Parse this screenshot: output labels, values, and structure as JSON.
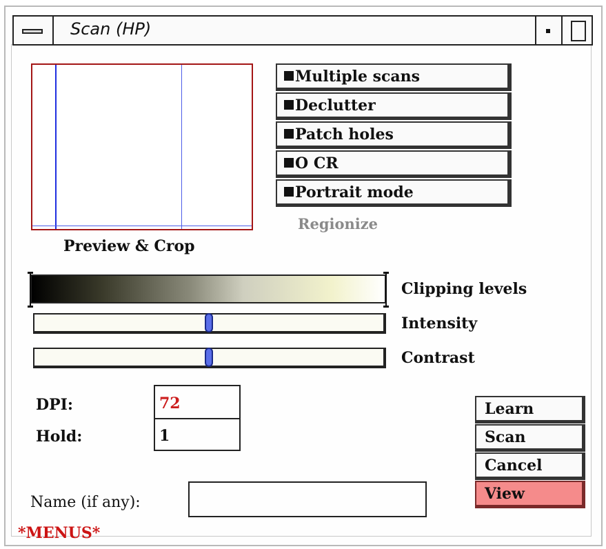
{
  "window": {
    "title": "Scan (HP)"
  },
  "titlebar_icons": {
    "menu": "window-menu-icon",
    "minimize": "minimize-icon",
    "maximize": "maximize-icon"
  },
  "preview": {
    "label": "Preview & Crop"
  },
  "options": [
    {
      "label": "Multiple scans"
    },
    {
      "label": "Declutter"
    },
    {
      "label": "Patch holes"
    },
    {
      "label": "O CR"
    },
    {
      "label": "Portrait mode"
    }
  ],
  "regionize": {
    "label": "Regionize"
  },
  "clipping": {
    "label": "Clipping levels",
    "low": 0,
    "high": 1
  },
  "intensity": {
    "label": "Intensity",
    "value": 0.5
  },
  "contrast": {
    "label": "Contrast",
    "value": 0.5
  },
  "dpi": {
    "label": "DPI:",
    "value": "72"
  },
  "hold": {
    "label": "Hold:",
    "value": "1"
  },
  "name": {
    "label": "Name (if any):",
    "value": ""
  },
  "actions": {
    "learn": "Learn",
    "scan": "Scan",
    "cancel": "Cancel",
    "view": "View"
  },
  "footer": {
    "menus": "*MENUS*"
  },
  "colors": {
    "preview_border": "#a31515",
    "crop_line": "#1e2ee0",
    "view_button": "#f58b8b",
    "dpi_value": "#cc1d1d"
  }
}
